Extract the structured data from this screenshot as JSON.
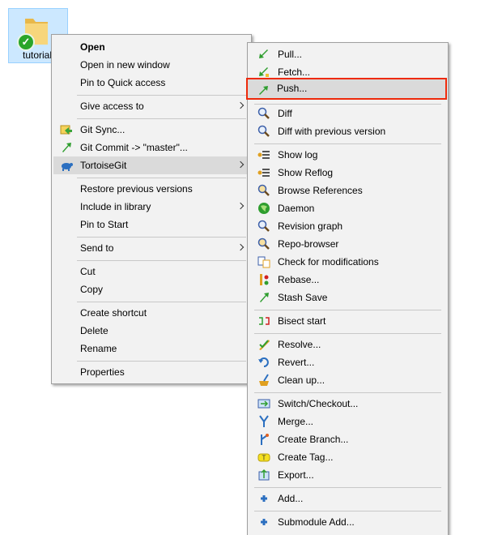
{
  "folder": {
    "label": "tutorial"
  },
  "main_menu": {
    "open": "Open",
    "open_new_window": "Open in new window",
    "pin_quick_access": "Pin to Quick access",
    "give_access_to": "Give access to",
    "git_sync": "Git Sync...",
    "git_commit": "Git Commit -> \"master\"...",
    "tortoisegit": "TortoiseGit",
    "restore_previous": "Restore previous versions",
    "include_library": "Include in library",
    "pin_start": "Pin to Start",
    "send_to": "Send to",
    "cut": "Cut",
    "copy": "Copy",
    "create_shortcut": "Create shortcut",
    "delete": "Delete",
    "rename": "Rename",
    "properties": "Properties"
  },
  "sub_menu": {
    "pull": "Pull...",
    "fetch": "Fetch...",
    "push": "Push...",
    "diff": "Diff",
    "diff_prev": "Diff with previous version",
    "show_log": "Show log",
    "show_reflog": "Show Reflog",
    "browse_refs": "Browse References",
    "daemon": "Daemon",
    "revision_graph": "Revision graph",
    "repo_browser": "Repo-browser",
    "check_mods": "Check for modifications",
    "rebase": "Rebase...",
    "stash_save": "Stash Save",
    "bisect_start": "Bisect start",
    "resolve": "Resolve...",
    "revert": "Revert...",
    "clean_up": "Clean up...",
    "switch_checkout": "Switch/Checkout...",
    "merge": "Merge...",
    "create_branch": "Create Branch...",
    "create_tag": "Create Tag...",
    "export": "Export...",
    "add": "Add...",
    "submodule_add": "Submodule Add..."
  },
  "colors": {
    "highlight_border": "#ee2a0b",
    "menu_bg": "#f2f2f2",
    "selection_bg": "#dadada",
    "folder_tile": "#cce8ff"
  }
}
